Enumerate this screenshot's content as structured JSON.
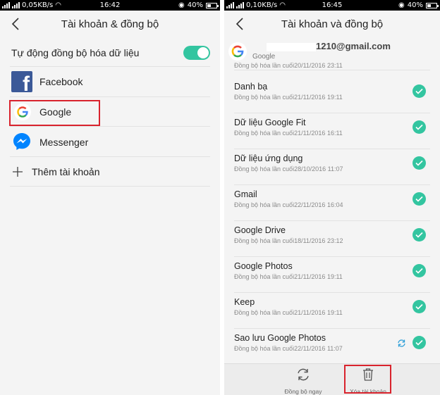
{
  "left": {
    "status": {
      "network_speed": "0,05KB/s",
      "time": "16:42",
      "battery": "40%"
    },
    "header": {
      "title": "Tài khoản & đồng bộ"
    },
    "auto_sync": {
      "label": "Tự động đồng bộ hóa dữ liệu",
      "enabled": true
    },
    "accounts": [
      {
        "label": "Facebook",
        "icon": "facebook-icon"
      },
      {
        "label": "Google",
        "icon": "google-icon"
      },
      {
        "label": "Messenger",
        "icon": "messenger-icon"
      }
    ],
    "add_account": {
      "label": "Thêm tài khoản",
      "icon": "plus-icon"
    }
  },
  "right": {
    "status": {
      "network_speed": "0,10KB/s",
      "time": "16:45",
      "battery": "40%"
    },
    "header": {
      "title": "Tài khoản và đồng bộ"
    },
    "account": {
      "email_visible": "1210@gmail.com",
      "type": "Google",
      "partial_line": "Đồng bộ hóa lần cuối20/11/2016 23:11"
    },
    "sync_items": [
      {
        "title": "Danh bạ",
        "date": "Đồng bộ hóa lần cuối21/11/2016 19:11",
        "checked": true
      },
      {
        "title": "Dữ liệu Google Fit",
        "date": "Đồng bộ hóa lần cuối21/11/2016 16:11",
        "checked": true
      },
      {
        "title": "Dữ liệu ứng dụng",
        "date": "Đồng bộ hóa lần cuối28/10/2016 11:07",
        "checked": true
      },
      {
        "title": "Gmail",
        "date": "Đồng bộ hóa lần cuối22/11/2016 16:04",
        "checked": true
      },
      {
        "title": "Google Drive",
        "date": "Đồng bộ hóa lần cuối18/11/2016 23:12",
        "checked": true
      },
      {
        "title": "Google Photos",
        "date": "Đồng bộ hóa lần cuối21/11/2016 19:11",
        "checked": true
      },
      {
        "title": "Keep",
        "date": "Đồng bộ hóa lần cuối21/11/2016 19:11",
        "checked": true
      },
      {
        "title": "Sao lưu Google Photos",
        "date": "Đồng bộ hóa lần cuối22/11/2016 11:07",
        "checked": true,
        "syncing": true
      }
    ],
    "bottom": {
      "sync_now": {
        "label": "Đồng bộ ngay",
        "icon": "sync-icon"
      },
      "remove_account": {
        "label": "Xóa tài khoản",
        "icon": "trash-icon"
      }
    }
  },
  "colors": {
    "accent": "#33c5a0",
    "highlight": "#d9232d",
    "facebook": "#3b5998",
    "messenger": "#0084ff"
  }
}
